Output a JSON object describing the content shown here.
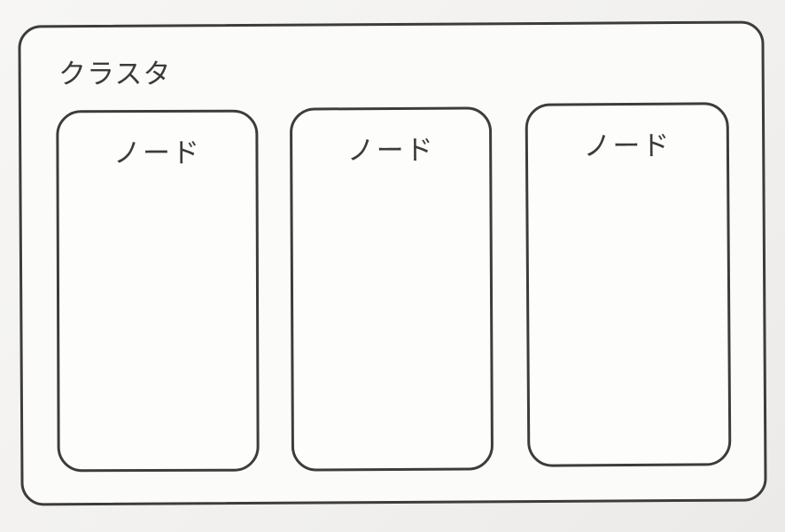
{
  "cluster": {
    "label": "クラスタ",
    "nodes": [
      {
        "label": "ノード"
      },
      {
        "label": "ノード"
      },
      {
        "label": "ノード"
      }
    ]
  },
  "colors": {
    "stroke": "#3e3b3c",
    "text": "#3b3b3b",
    "background": "#f4f3f1"
  }
}
